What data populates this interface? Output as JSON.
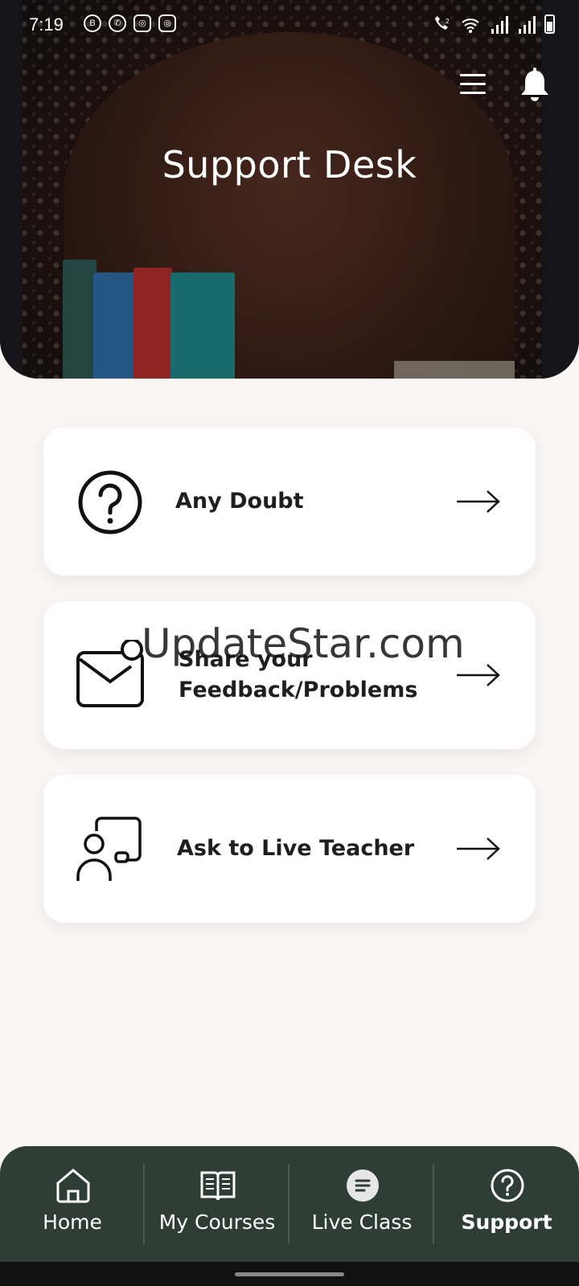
{
  "status_bar": {
    "time": "7:19",
    "notification_icons": [
      "business-chat-icon",
      "whatsapp-icon",
      "instagram-icon",
      "instagram-icon"
    ],
    "system_icons": [
      "wifi-call-icon",
      "wifi-icon",
      "signal-icon",
      "signal-icon",
      "battery-icon"
    ]
  },
  "header": {
    "title": "Support Desk",
    "menu_icon": "hamburger-menu-icon",
    "bell_icon": "bell-icon"
  },
  "options": [
    {
      "label": "Any Doubt",
      "icon": "question-circle-icon"
    },
    {
      "label": "Share your Feedback/Problems",
      "icon": "mail-notification-icon"
    },
    {
      "label": "Ask to Live Teacher",
      "icon": "teacher-board-icon"
    }
  ],
  "watermark": "UpdateStar.com",
  "bottom_nav": {
    "items": [
      {
        "label": "Home",
        "icon": "home-icon"
      },
      {
        "label": "My Courses",
        "icon": "book-icon"
      },
      {
        "label": "Live Class",
        "icon": "chat-bubble-icon"
      },
      {
        "label": "Support",
        "icon": "question-circle-icon"
      }
    ],
    "active": "Support"
  },
  "colors": {
    "background": "#f8f5f4",
    "nav_background": "#2e3e36",
    "card_background": "#ffffff",
    "text_dark": "#1f1f1f"
  }
}
